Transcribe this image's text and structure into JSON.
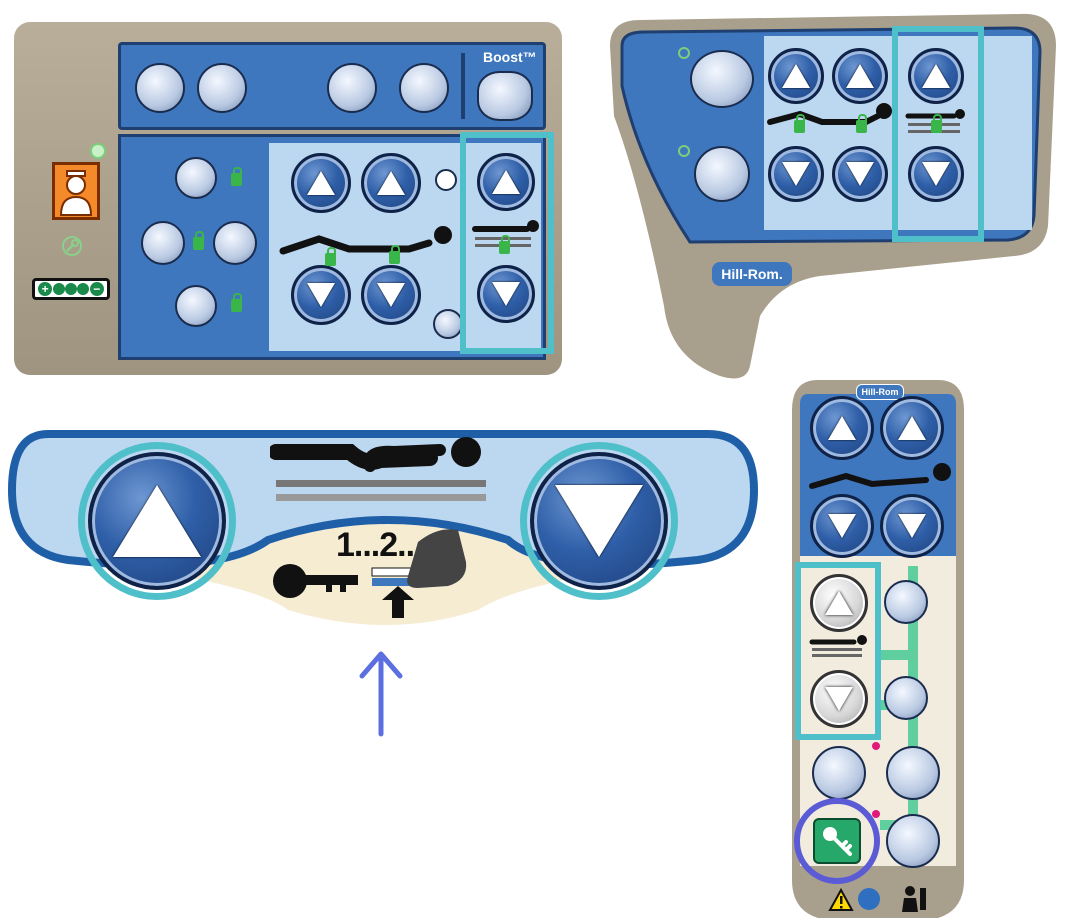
{
  "panel_top_left": {
    "boost_label": "Boost™",
    "battery_symbols": [
      "+",
      "−"
    ]
  },
  "panel_top_right": {
    "brand": "Hill-Rom."
  },
  "footboard": {
    "count_label": "1...2..."
  },
  "pendant": {
    "brand": "Hill-Rom"
  },
  "colors": {
    "teal_highlight": "#4fbfc9",
    "key_circle": "#5b5bd6",
    "arrow": "#5b6fe0",
    "panel_tan": "#a89f8c",
    "panel_blue": "#3f77bf",
    "panel_light_blue": "#bcd7f0"
  }
}
